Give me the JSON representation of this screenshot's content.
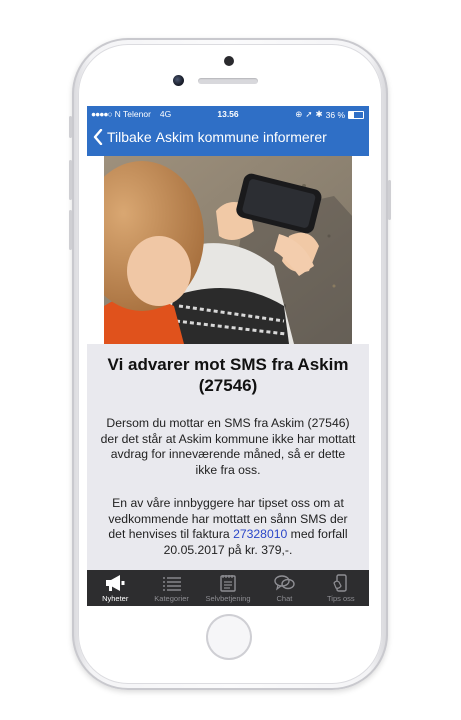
{
  "status_bar": {
    "carrier": "N Telenor",
    "network": "4G",
    "time": "13.56",
    "battery": "36 %"
  },
  "nav": {
    "back_label": "Tilbake",
    "title": "Askim kommune informerer"
  },
  "article": {
    "headline": "Vi advarer mot SMS fra Askim (27546)",
    "para1": "Dersom du mottar en SMS fra Askim (27546) der det står at Askim kommune ikke har mottatt avdrag for inneværende måned, så er dette ikke fra oss.",
    "para2_before": "En av våre innbyggere har tipset oss om at vedkommende har mottatt en sånn SMS der det henvises til faktura ",
    "para2_link": "27328010",
    "para2_after": " med forfall 20.05.2017 på kr. 379,-."
  },
  "tabs": [
    {
      "label": "Nyheter",
      "icon": "megaphone-icon",
      "active": true
    },
    {
      "label": "Kategorier",
      "icon": "list-icon",
      "active": false
    },
    {
      "label": "Selvbetjening",
      "icon": "notepad-icon",
      "active": false
    },
    {
      "label": "Chat",
      "icon": "chat-bubbles-icon",
      "active": false
    },
    {
      "label": "Tips oss",
      "icon": "phone-tip-icon",
      "active": false
    }
  ],
  "colors": {
    "accent": "#2f6fc6",
    "tabbar": "#2d2d2f",
    "content_bg": "#e9e9ee",
    "link": "#2a46c8"
  }
}
